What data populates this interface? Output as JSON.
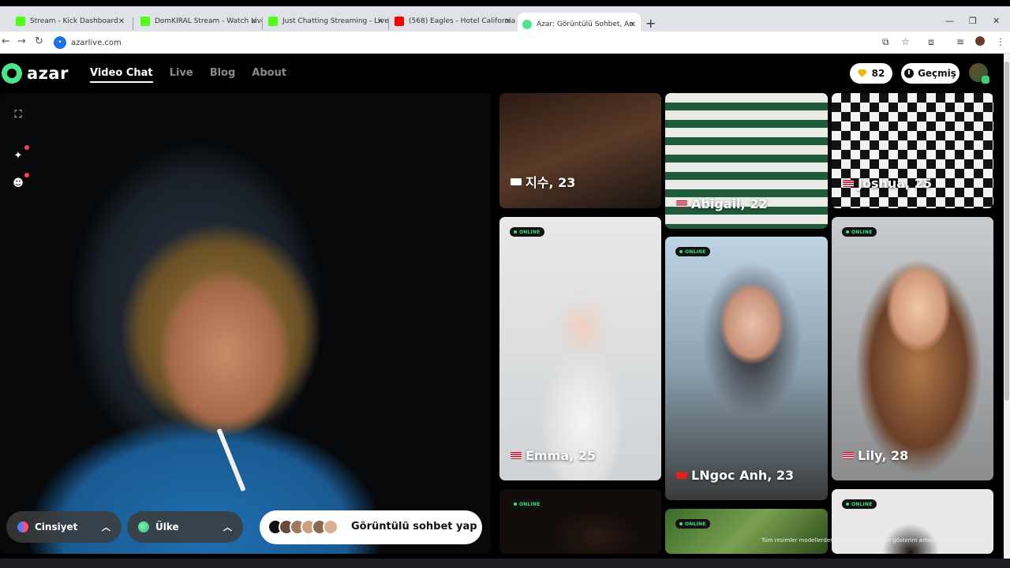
{
  "browser": {
    "tabs": [
      {
        "title": "Stream - Kick Dashboard",
        "color": "#53fc18"
      },
      {
        "title": "DomKIRAL Stream - Watch Live",
        "color": "#53fc18"
      },
      {
        "title": "Just Chatting Streaming - Live",
        "color": "#53fc18"
      },
      {
        "title": "(568) Eagles - Hotel California",
        "color": "#ff0000"
      },
      {
        "title": "Azar: Görüntülü Sohbet, An",
        "color": "#4ce58b"
      }
    ],
    "url": "azarlive.com"
  },
  "app": {
    "logo": "azar",
    "nav": [
      "Video Chat",
      "Live",
      "Blog",
      "About"
    ],
    "gems": "82",
    "history_label": "Geçmiş"
  },
  "filters": {
    "gender_label": "Cinsiyet",
    "country_label": "Ülke",
    "start_label": "Görüntülü sohbet yap"
  },
  "online_badge": "ONLINE",
  "cards": [
    {
      "caption": "지수, 23",
      "flag": "kr"
    },
    {
      "caption": "Abigail, 22",
      "flag": "us"
    },
    {
      "caption": "Joshua, 25",
      "flag": "us"
    },
    {
      "caption": "Emma, 25",
      "flag": "us"
    },
    {
      "caption": "LNgoc Anh, 23",
      "flag": "vn"
    },
    {
      "caption": "Lily, 28",
      "flag": "us"
    }
  ],
  "disclaimer": "Tüm resimler modellerden alınmıştır ve sadece gösterim amaçlı kullanılmaktadır."
}
